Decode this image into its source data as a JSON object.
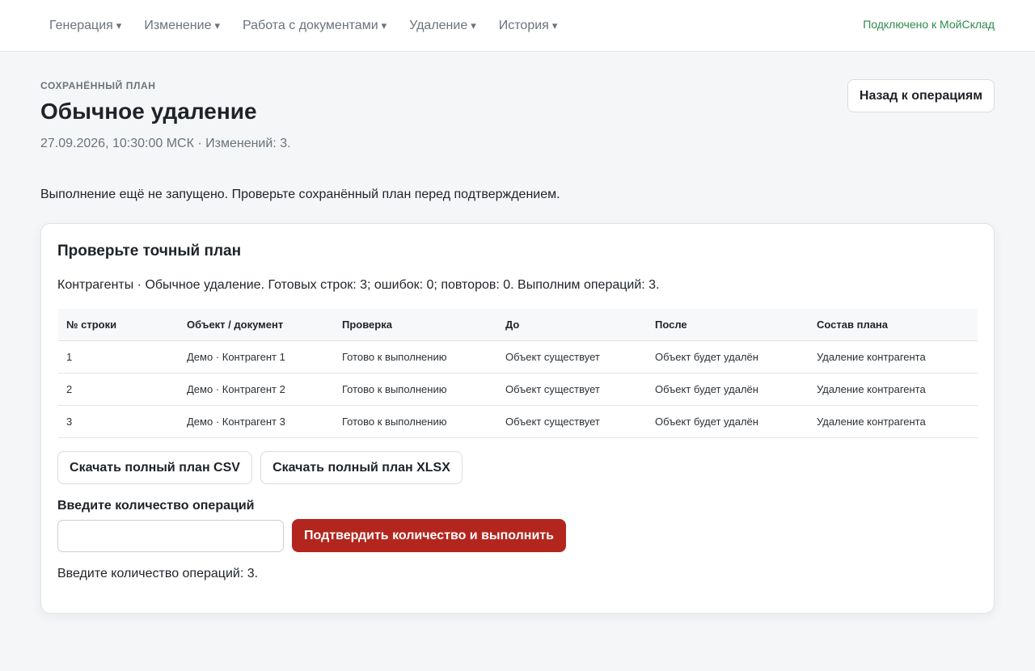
{
  "nav": {
    "items": [
      {
        "label": "Генерация",
        "caret": "▾"
      },
      {
        "label": "Изменение",
        "caret": "▾"
      },
      {
        "label": "Работа с документами",
        "caret": "▾"
      },
      {
        "label": "Удаление",
        "caret": "▾"
      },
      {
        "label": "История",
        "caret": "▾"
      }
    ],
    "connection_status": "Подключено к МойСклад"
  },
  "header": {
    "eyebrow": "СОХРАНЁННЫЙ ПЛАН",
    "title": "Обычное удаление",
    "meta": "27.09.2026, 10:30:00 МСК · Изменений: 3.",
    "back_label": "Назад к операциям"
  },
  "status_text": "Выполнение ещё не запущено. Проверьте сохранённый план перед подтверждением.",
  "plan": {
    "title": "Проверьте точный план",
    "summary": "Контрагенты · Обычное удаление. Готовых строк: 3; ошибок: 0; повторов: 0. Выполним операций: 3.",
    "columns": [
      "№ строки",
      "Объект / документ",
      "Проверка",
      "До",
      "После",
      "Состав плана"
    ],
    "rows": [
      [
        "1",
        "Демо · Контрагент 1",
        "Готово к выполнению",
        "Объект существует",
        "Объект будет удалён",
        "Удаление контрагента"
      ],
      [
        "2",
        "Демо · Контрагент 2",
        "Готово к выполнению",
        "Объект существует",
        "Объект будет удалён",
        "Удаление контрагента"
      ],
      [
        "3",
        "Демо · Контрагент 3",
        "Готово к выполнению",
        "Объект существует",
        "Объект будет удалён",
        "Удаление контрагента"
      ]
    ],
    "download_csv_label": "Скачать полный план CSV",
    "download_xlsx_label": "Скачать полный план XLSX",
    "quantity_label": "Введите количество операций",
    "quantity_value": "",
    "confirm_label": "Подтвердить количество и выполнить",
    "hint": "Введите количество операций: 3."
  },
  "colors": {
    "accent_danger": "#b3261e",
    "connected": "#2f8a4f",
    "muted_text": "#6b737b"
  }
}
